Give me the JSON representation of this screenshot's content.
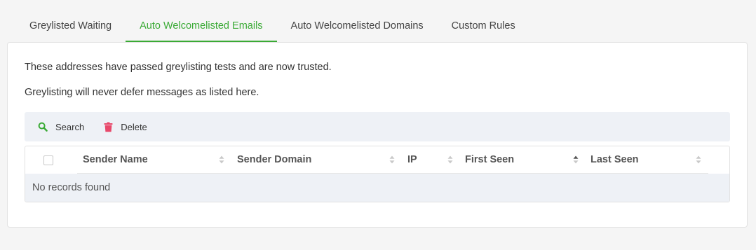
{
  "tabs": [
    {
      "label": "Greylisted Waiting",
      "active": false
    },
    {
      "label": "Auto Welcomelisted Emails",
      "active": true
    },
    {
      "label": "Auto Welcomelisted Domains",
      "active": false
    },
    {
      "label": "Custom Rules",
      "active": false
    }
  ],
  "description": {
    "line1": "These addresses have passed greylisting tests and are now trusted.",
    "line2": "Greylisting will never defer messages as listed here."
  },
  "toolbar": {
    "search_label": "Search",
    "delete_label": "Delete",
    "search_icon": "search-icon",
    "delete_icon": "trash-icon"
  },
  "table": {
    "columns": [
      {
        "label": "Sender Name",
        "sort": "none"
      },
      {
        "label": "Sender Domain",
        "sort": "none"
      },
      {
        "label": "IP",
        "sort": "none"
      },
      {
        "label": "First Seen",
        "sort": "ascending"
      },
      {
        "label": "Last Seen",
        "sort": "none"
      }
    ],
    "empty_text": "No records found"
  },
  "colors": {
    "accent": "#3aaa35",
    "delete": "#e8486a",
    "toolbar_bg": "#eef1f6"
  }
}
